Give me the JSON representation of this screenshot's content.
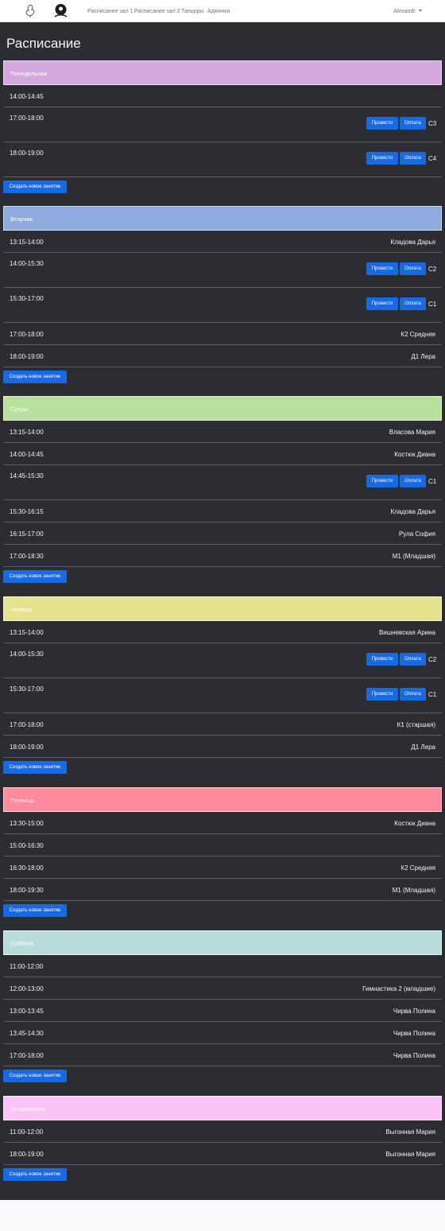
{
  "nav": {
    "links": [
      "Расписание зал 1",
      "Расписание зал 2",
      "Танцоры",
      "Админка"
    ],
    "user": "Alexandr"
  },
  "page": {
    "title": "Расписание"
  },
  "buttons": {
    "conduct": "Провести",
    "payment": "Оплата",
    "create": "Создать новое занятие"
  },
  "days": [
    {
      "name": "Понедельник",
      "color": "#d3a8dc",
      "lessons": [
        {
          "time": "14:00-14:45"
        },
        {
          "time": "17:00-18:00",
          "group": "С3"
        },
        {
          "time": "18:00-19:00",
          "group": "С4"
        }
      ]
    },
    {
      "name": "Вторник",
      "color": "#8fabdd",
      "lessons": [
        {
          "time": "13:15-14:00",
          "who": "Кладова Дарья"
        },
        {
          "time": "14:00-15:30",
          "group": "С2"
        },
        {
          "time": "15:30-17:00",
          "group": "С1"
        },
        {
          "time": "17:00-18:00",
          "who": "К2 Средняя"
        },
        {
          "time": "18:00-19:00",
          "who": "Д1 Лера"
        }
      ]
    },
    {
      "name": "Среда",
      "color": "#b9df9f",
      "lessons": [
        {
          "time": "13:15-14:00",
          "who": "Власова Мария"
        },
        {
          "time": "14:00-14:45",
          "who": "Костюк Диана"
        },
        {
          "time": "14:45-15:30",
          "group": "С1"
        },
        {
          "time": "15:30-16:15",
          "who": "Кладова Дарья"
        },
        {
          "time": "16:15-17:00",
          "who": "Рула София"
        },
        {
          "time": "17:00-18:30",
          "who": "М1 (Младшая)"
        }
      ]
    },
    {
      "name": "Четверг",
      "color": "#e6e38e",
      "lessons": [
        {
          "time": "13:15-14:00",
          "who": "Вишневская Арина"
        },
        {
          "time": "14:00-15:30",
          "group": "С2"
        },
        {
          "time": "15:30-17:00",
          "group": "С1"
        },
        {
          "time": "17:00-18:00",
          "who": "К1 (старшая)"
        },
        {
          "time": "18:00-19:00",
          "who": "Д1 Лера"
        }
      ]
    },
    {
      "name": "Пятница",
      "color": "#ff8b9c",
      "lessons": [
        {
          "time": "13:30-15:00",
          "who": "Костюк Диана"
        },
        {
          "time": "15:00-16:30"
        },
        {
          "time": "16:30-18:00",
          "who": "К2 Средняя"
        },
        {
          "time": "18:00-19:30",
          "who": "М1 (Младшая)"
        }
      ]
    },
    {
      "name": "Суббота",
      "color": "#b6dcdb",
      "lessons": [
        {
          "time": "11:00-12:00"
        },
        {
          "time": "12:00-13:00",
          "who": "Гимнастика 2 (младшие)"
        },
        {
          "time": "13:00-13:45",
          "who": "Чирва Полина"
        },
        {
          "time": "13:45-14:30",
          "who": "Чирва Полина"
        },
        {
          "time": "17:00-18:00",
          "who": "Чирва Полина"
        }
      ]
    },
    {
      "name": "Воскресенье",
      "color": "#fcc3f7",
      "lessons": [
        {
          "time": "11:00-12:00",
          "who": "Выгонная Мария"
        },
        {
          "time": "18:00-19:00",
          "who": "Выгонная Мария"
        }
      ]
    }
  ]
}
